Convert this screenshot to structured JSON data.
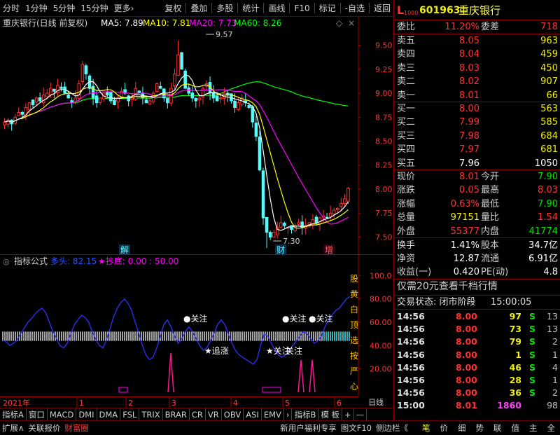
{
  "toolbar": {
    "left": [
      "分时",
      "1分钟",
      "5分钟",
      "15分钟",
      "更多›"
    ],
    "right": [
      "复权",
      "叠加",
      "多股",
      "统计",
      "画线",
      "F10",
      "标记",
      "-自选",
      "返回"
    ]
  },
  "main_header": {
    "title": "重庆银行(日线 前复权)",
    "ma5": "MA5: 7.89",
    "ma10": "MA10: 7.81",
    "ma20": "MA20: 7.73",
    "ma60": "MA60: 8.26"
  },
  "annotations": {
    "high": "9.57",
    "low": "7.30",
    "marker_jie": "解",
    "marker_cai": "财",
    "marker_zeng": "增"
  },
  "indicator_header": {
    "name": "指标公式",
    "duotou": "多头: 82.15",
    "chaodi": "★抄底: 0.00 : 50.00"
  },
  "indicator_labels": [
    "●关注",
    "●关注",
    "●关注",
    "★追涨",
    "★关注",
    "关注"
  ],
  "side_text": [
    "股",
    "黄",
    "白",
    "顶",
    "选",
    "按",
    "严",
    "心"
  ],
  "date_axis": {
    "year": "2021年",
    "months": [
      "1",
      "2",
      "3",
      "4",
      "5",
      "6"
    ],
    "right_label": "日线"
  },
  "tabs": [
    "指标A",
    "窗口",
    "MACD",
    "DMI",
    "DMA",
    "FSL",
    "TRIX",
    "BRAR",
    "CR",
    "VR",
    "OBV",
    "ASI",
    "EMV",
    "›",
    "指标B",
    "模 板",
    "+",
    "—"
  ],
  "bottombar": {
    "left": [
      "扩展∧",
      "关联报价",
      "财富圈"
    ],
    "ad": "新用户福利专享",
    "mid": [
      "图文F10",
      "侧边栏《"
    ],
    "right": [
      "笔",
      "价",
      "细",
      "势",
      "联",
      "值",
      "主",
      "全"
    ]
  },
  "panel": {
    "logo": "L",
    "logo_sub": "1000",
    "code": "601963",
    "name": "重庆银行",
    "weibi_label": "委比",
    "weibi": "11.20%",
    "weicha_label": "委差",
    "weicha": "718",
    "asks": [
      {
        "label": "卖五",
        "price": "8.05",
        "vol": "963"
      },
      {
        "label": "卖四",
        "price": "8.04",
        "vol": "459"
      },
      {
        "label": "卖三",
        "price": "8.03",
        "vol": "450"
      },
      {
        "label": "卖二",
        "price": "8.02",
        "vol": "907"
      },
      {
        "label": "卖一",
        "price": "8.01",
        "vol": "66"
      }
    ],
    "bids": [
      {
        "label": "买一",
        "price": "8.00",
        "vol": "563"
      },
      {
        "label": "买二",
        "price": "7.99",
        "vol": "585"
      },
      {
        "label": "买三",
        "price": "7.98",
        "vol": "684"
      },
      {
        "label": "买四",
        "price": "7.97",
        "vol": "681"
      },
      {
        "label": "买五",
        "price": "7.96",
        "vol": "1050"
      }
    ],
    "quote": [
      {
        "l": "现价",
        "v": "8.01",
        "vc": "red",
        "l2": "今开",
        "v2": "7.90",
        "v2c": "green"
      },
      {
        "l": "涨跌",
        "v": "0.05",
        "vc": "red",
        "l2": "最高",
        "v2": "8.03",
        "v2c": "red"
      },
      {
        "l": "涨幅",
        "v": "0.63%",
        "vc": "red",
        "l2": "最低",
        "v2": "7.90",
        "v2c": "green"
      },
      {
        "l": "总量",
        "v": "97151",
        "vc": "yellow",
        "l2": "量比",
        "v2": "1.54",
        "v2c": "red"
      },
      {
        "l": "外盘",
        "v": "55377",
        "vc": "red",
        "l2": "内盘",
        "v2": "41774",
        "v2c": "green"
      }
    ],
    "stats": [
      {
        "l": "换手",
        "v": "1.41%",
        "l2": "股本",
        "v2": "34.7亿"
      },
      {
        "l": "净资",
        "v": "12.87",
        "l2": "流通",
        "v2": "6.91亿"
      },
      {
        "l": "收益(一)",
        "v": "0.420",
        "l2": "PE(动)",
        "v2": "4.8"
      }
    ],
    "promo": "仅需20元查看千档行情",
    "trade_status_label": "交易状态: 闭市阶段",
    "trade_status_time": "15:00:05",
    "ticks": [
      {
        "t": "14:56",
        "p": "8.00",
        "v": "97",
        "s": "S",
        "n": "13"
      },
      {
        "t": "14:56",
        "p": "8.00",
        "v": "73",
        "s": "S",
        "n": "13"
      },
      {
        "t": "14:56",
        "p": "8.00",
        "v": "79",
        "s": "S",
        "n": "2"
      },
      {
        "t": "14:56",
        "p": "8.00",
        "v": "1",
        "s": "S",
        "n": "1"
      },
      {
        "t": "14:56",
        "p": "8.00",
        "v": "46",
        "s": "S",
        "n": "4"
      },
      {
        "t": "14:56",
        "p": "8.00",
        "v": "28",
        "s": "S",
        "n": "1"
      },
      {
        "t": "14:56",
        "p": "8.00",
        "v": "36",
        "s": "S",
        "n": "2"
      },
      {
        "t": "15:00",
        "p": "8.01",
        "v": "1860",
        "s": "",
        "n": "98"
      }
    ]
  },
  "chart_data": {
    "type": "candlestick",
    "price_axis": [
      "9.50",
      "9.25",
      "9.00",
      "8.75",
      "8.50",
      "8.25",
      "8.00",
      "7.75",
      "7.50"
    ],
    "price_range": [
      7.35,
      9.65
    ],
    "indicator_axis": [
      "100.0",
      "80.00",
      "60.00",
      "40.00",
      "20.00"
    ],
    "indicator_range": [
      0,
      108
    ],
    "colors": {
      "up": "#ff3232",
      "down": "#54fcfc",
      "ma5": "#ffffff",
      "ma10": "#ffff00",
      "ma20": "#ff00ff",
      "ma60": "#00ff00",
      "duotou": "#3030ff"
    },
    "closes": [
      8.7,
      8.72,
      8.68,
      8.75,
      8.8,
      8.78,
      8.85,
      8.9,
      8.88,
      8.95,
      8.92,
      8.98,
      9.0,
      9.05,
      9.02,
      9.08,
      9.05,
      9.0,
      8.95,
      8.9,
      8.95,
      9.1,
      9.3,
      9.2,
      9.05,
      8.95,
      8.9,
      8.95,
      9.0,
      8.98,
      8.92,
      8.88,
      8.95,
      9.02,
      9.0,
      8.92,
      8.95,
      9.05,
      9.0,
      8.95,
      8.9,
      8.92,
      9.0,
      9.1,
      9.05,
      8.95,
      8.9,
      9.05,
      9.2,
      9.4,
      9.25,
      9.05,
      9.0,
      8.95,
      8.92,
      8.95,
      9.05,
      9.1,
      9.0,
      8.95,
      8.92,
      8.95,
      9.0,
      8.98,
      8.92,
      8.85,
      8.9,
      8.95,
      8.9,
      8.85,
      8.7,
      8.55,
      8.2,
      7.7,
      7.55,
      7.5,
      7.55,
      7.6,
      7.65,
      7.62,
      7.6,
      7.58,
      7.62,
      7.65,
      7.6,
      7.62,
      7.65,
      7.68,
      7.65,
      7.7,
      7.72,
      7.7,
      7.75,
      7.78,
      7.8,
      7.85,
      7.9,
      8.01
    ],
    "duotou": [
      45,
      43,
      40,
      42,
      45,
      50,
      55,
      60,
      63,
      67,
      70,
      72,
      68,
      60,
      52,
      46,
      40,
      38,
      42,
      50,
      58,
      62,
      66,
      64,
      60,
      52,
      45,
      40,
      38,
      45,
      55,
      65,
      72,
      77,
      80,
      76,
      70,
      60,
      50,
      40,
      32,
      28,
      30,
      38,
      48,
      58,
      62,
      56,
      48,
      42,
      46,
      52,
      56,
      52,
      46,
      40,
      36,
      38,
      44,
      50,
      58,
      62,
      58,
      50,
      42,
      36,
      32,
      30,
      28,
      26,
      24,
      28,
      40,
      50,
      48,
      42,
      36,
      32,
      30,
      32,
      36,
      40,
      44,
      48,
      52,
      50,
      46,
      42,
      44,
      48,
      56,
      62,
      66,
      70,
      72,
      76,
      80,
      82
    ]
  }
}
